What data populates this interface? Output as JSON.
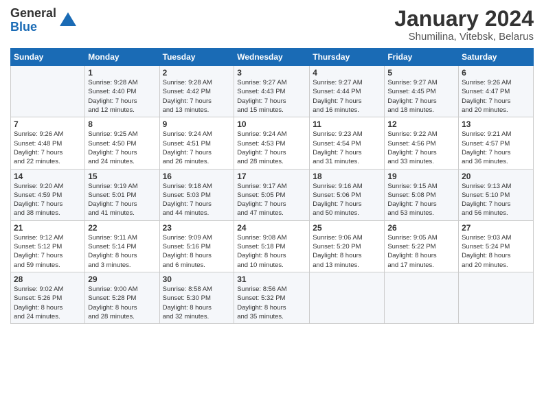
{
  "logo": {
    "line1": "General",
    "line2": "Blue"
  },
  "title": "January 2024",
  "subtitle": "Shumilina, Vitebsk, Belarus",
  "weekdays": [
    "Sunday",
    "Monday",
    "Tuesday",
    "Wednesday",
    "Thursday",
    "Friday",
    "Saturday"
  ],
  "weeks": [
    [
      {
        "day": "",
        "info": ""
      },
      {
        "day": "1",
        "info": "Sunrise: 9:28 AM\nSunset: 4:40 PM\nDaylight: 7 hours\nand 12 minutes."
      },
      {
        "day": "2",
        "info": "Sunrise: 9:28 AM\nSunset: 4:42 PM\nDaylight: 7 hours\nand 13 minutes."
      },
      {
        "day": "3",
        "info": "Sunrise: 9:27 AM\nSunset: 4:43 PM\nDaylight: 7 hours\nand 15 minutes."
      },
      {
        "day": "4",
        "info": "Sunrise: 9:27 AM\nSunset: 4:44 PM\nDaylight: 7 hours\nand 16 minutes."
      },
      {
        "day": "5",
        "info": "Sunrise: 9:27 AM\nSunset: 4:45 PM\nDaylight: 7 hours\nand 18 minutes."
      },
      {
        "day": "6",
        "info": "Sunrise: 9:26 AM\nSunset: 4:47 PM\nDaylight: 7 hours\nand 20 minutes."
      }
    ],
    [
      {
        "day": "7",
        "info": "Sunrise: 9:26 AM\nSunset: 4:48 PM\nDaylight: 7 hours\nand 22 minutes."
      },
      {
        "day": "8",
        "info": "Sunrise: 9:25 AM\nSunset: 4:50 PM\nDaylight: 7 hours\nand 24 minutes."
      },
      {
        "day": "9",
        "info": "Sunrise: 9:24 AM\nSunset: 4:51 PM\nDaylight: 7 hours\nand 26 minutes."
      },
      {
        "day": "10",
        "info": "Sunrise: 9:24 AM\nSunset: 4:53 PM\nDaylight: 7 hours\nand 28 minutes."
      },
      {
        "day": "11",
        "info": "Sunrise: 9:23 AM\nSunset: 4:54 PM\nDaylight: 7 hours\nand 31 minutes."
      },
      {
        "day": "12",
        "info": "Sunrise: 9:22 AM\nSunset: 4:56 PM\nDaylight: 7 hours\nand 33 minutes."
      },
      {
        "day": "13",
        "info": "Sunrise: 9:21 AM\nSunset: 4:57 PM\nDaylight: 7 hours\nand 36 minutes."
      }
    ],
    [
      {
        "day": "14",
        "info": "Sunrise: 9:20 AM\nSunset: 4:59 PM\nDaylight: 7 hours\nand 38 minutes."
      },
      {
        "day": "15",
        "info": "Sunrise: 9:19 AM\nSunset: 5:01 PM\nDaylight: 7 hours\nand 41 minutes."
      },
      {
        "day": "16",
        "info": "Sunrise: 9:18 AM\nSunset: 5:03 PM\nDaylight: 7 hours\nand 44 minutes."
      },
      {
        "day": "17",
        "info": "Sunrise: 9:17 AM\nSunset: 5:05 PM\nDaylight: 7 hours\nand 47 minutes."
      },
      {
        "day": "18",
        "info": "Sunrise: 9:16 AM\nSunset: 5:06 PM\nDaylight: 7 hours\nand 50 minutes."
      },
      {
        "day": "19",
        "info": "Sunrise: 9:15 AM\nSunset: 5:08 PM\nDaylight: 7 hours\nand 53 minutes."
      },
      {
        "day": "20",
        "info": "Sunrise: 9:13 AM\nSunset: 5:10 PM\nDaylight: 7 hours\nand 56 minutes."
      }
    ],
    [
      {
        "day": "21",
        "info": "Sunrise: 9:12 AM\nSunset: 5:12 PM\nDaylight: 7 hours\nand 59 minutes."
      },
      {
        "day": "22",
        "info": "Sunrise: 9:11 AM\nSunset: 5:14 PM\nDaylight: 8 hours\nand 3 minutes."
      },
      {
        "day": "23",
        "info": "Sunrise: 9:09 AM\nSunset: 5:16 PM\nDaylight: 8 hours\nand 6 minutes."
      },
      {
        "day": "24",
        "info": "Sunrise: 9:08 AM\nSunset: 5:18 PM\nDaylight: 8 hours\nand 10 minutes."
      },
      {
        "day": "25",
        "info": "Sunrise: 9:06 AM\nSunset: 5:20 PM\nDaylight: 8 hours\nand 13 minutes."
      },
      {
        "day": "26",
        "info": "Sunrise: 9:05 AM\nSunset: 5:22 PM\nDaylight: 8 hours\nand 17 minutes."
      },
      {
        "day": "27",
        "info": "Sunrise: 9:03 AM\nSunset: 5:24 PM\nDaylight: 8 hours\nand 20 minutes."
      }
    ],
    [
      {
        "day": "28",
        "info": "Sunrise: 9:02 AM\nSunset: 5:26 PM\nDaylight: 8 hours\nand 24 minutes."
      },
      {
        "day": "29",
        "info": "Sunrise: 9:00 AM\nSunset: 5:28 PM\nDaylight: 8 hours\nand 28 minutes."
      },
      {
        "day": "30",
        "info": "Sunrise: 8:58 AM\nSunset: 5:30 PM\nDaylight: 8 hours\nand 32 minutes."
      },
      {
        "day": "31",
        "info": "Sunrise: 8:56 AM\nSunset: 5:32 PM\nDaylight: 8 hours\nand 35 minutes."
      },
      {
        "day": "",
        "info": ""
      },
      {
        "day": "",
        "info": ""
      },
      {
        "day": "",
        "info": ""
      }
    ]
  ]
}
